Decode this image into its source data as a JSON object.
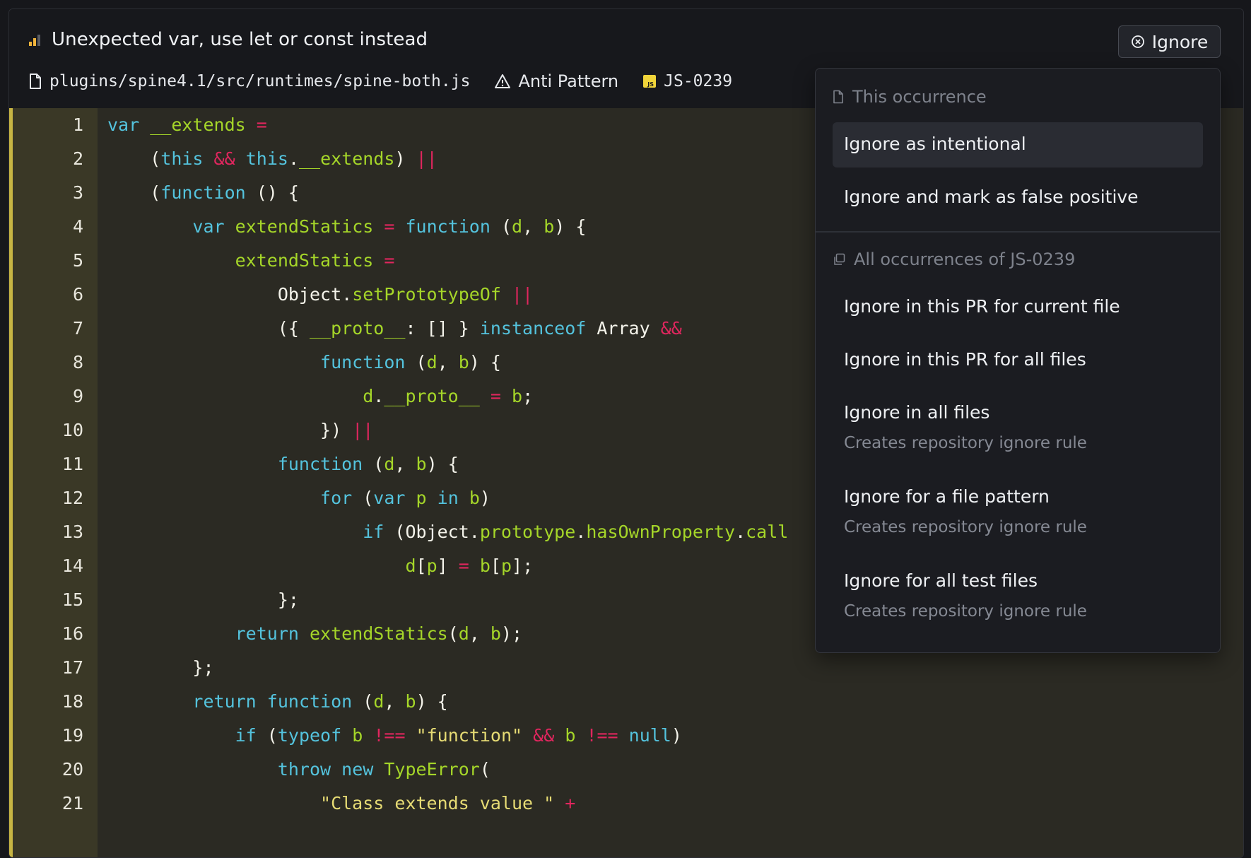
{
  "issue": {
    "title": "Unexpected var, use let or const instead",
    "file_path": "plugins/spine4.1/src/runtimes/spine-both.js",
    "category": "Anti Pattern",
    "language_badge": "JS",
    "issue_code": "JS-0239"
  },
  "ignore_button": {
    "label": "Ignore"
  },
  "dropdown": {
    "section_this": {
      "title": "This occurrence",
      "items": [
        {
          "label": "Ignore as intentional"
        },
        {
          "label": "Ignore and mark as false positive"
        }
      ]
    },
    "section_all": {
      "title": "All occurrences of JS-0239",
      "items": [
        {
          "label": "Ignore in this PR for current file"
        },
        {
          "label": "Ignore in this PR for all files"
        },
        {
          "label": "Ignore in all files",
          "sub": "Creates repository ignore rule"
        },
        {
          "label": "Ignore for a file pattern",
          "sub": "Creates repository ignore rule"
        },
        {
          "label": "Ignore for all test files",
          "sub": "Creates repository ignore rule"
        }
      ]
    }
  },
  "code": {
    "line_numbers": [
      "1",
      "2",
      "3",
      "4",
      "5",
      "6",
      "7",
      "8",
      "9",
      "10",
      "11",
      "12",
      "13",
      "14",
      "15",
      "16",
      "17",
      "18",
      "19",
      "20",
      "21"
    ],
    "lines": [
      [
        [
          "k",
          "var"
        ],
        [
          "w",
          " "
        ],
        [
          "f",
          "__extends"
        ],
        [
          "w",
          " "
        ],
        [
          "p",
          "="
        ]
      ],
      [
        [
          "w",
          "    ("
        ],
        [
          "k",
          "this"
        ],
        [
          "w",
          " "
        ],
        [
          "p",
          "&&"
        ],
        [
          "w",
          " "
        ],
        [
          "k",
          "this"
        ],
        [
          "w",
          "."
        ],
        [
          "f",
          "__extends"
        ],
        [
          "w",
          ") "
        ],
        [
          "p",
          "||"
        ]
      ],
      [
        [
          "w",
          "    ("
        ],
        [
          "k",
          "function"
        ],
        [
          "w",
          " () {"
        ]
      ],
      [
        [
          "w",
          "        "
        ],
        [
          "k",
          "var"
        ],
        [
          "w",
          " "
        ],
        [
          "f",
          "extendStatics"
        ],
        [
          "w",
          " "
        ],
        [
          "p",
          "="
        ],
        [
          "w",
          " "
        ],
        [
          "k",
          "function"
        ],
        [
          "w",
          " ("
        ],
        [
          "f",
          "d"
        ],
        [
          "w",
          ", "
        ],
        [
          "f",
          "b"
        ],
        [
          "w",
          ") {"
        ]
      ],
      [
        [
          "w",
          "            "
        ],
        [
          "f",
          "extendStatics"
        ],
        [
          "w",
          " "
        ],
        [
          "p",
          "="
        ]
      ],
      [
        [
          "w",
          "                Object."
        ],
        [
          "f",
          "setPrototypeOf"
        ],
        [
          "w",
          " "
        ],
        [
          "p",
          "||"
        ]
      ],
      [
        [
          "w",
          "                ({ "
        ],
        [
          "f",
          "__proto__"
        ],
        [
          "w",
          ": [] } "
        ],
        [
          "k",
          "instanceof"
        ],
        [
          "w",
          " Array "
        ],
        [
          "p",
          "&&"
        ]
      ],
      [
        [
          "w",
          "                    "
        ],
        [
          "k",
          "function"
        ],
        [
          "w",
          " ("
        ],
        [
          "f",
          "d"
        ],
        [
          "w",
          ", "
        ],
        [
          "f",
          "b"
        ],
        [
          "w",
          ") {"
        ]
      ],
      [
        [
          "w",
          "                        "
        ],
        [
          "f",
          "d"
        ],
        [
          "w",
          "."
        ],
        [
          "f",
          "__proto__"
        ],
        [
          "w",
          " "
        ],
        [
          "p",
          "="
        ],
        [
          "w",
          " "
        ],
        [
          "f",
          "b"
        ],
        [
          "w",
          ";"
        ]
      ],
      [
        [
          "w",
          "                    }) "
        ],
        [
          "p",
          "||"
        ]
      ],
      [
        [
          "w",
          "                "
        ],
        [
          "k",
          "function"
        ],
        [
          "w",
          " ("
        ],
        [
          "f",
          "d"
        ],
        [
          "w",
          ", "
        ],
        [
          "f",
          "b"
        ],
        [
          "w",
          ") {"
        ]
      ],
      [
        [
          "w",
          "                    "
        ],
        [
          "k",
          "for"
        ],
        [
          "w",
          " ("
        ],
        [
          "k",
          "var"
        ],
        [
          "w",
          " "
        ],
        [
          "f",
          "p"
        ],
        [
          "w",
          " "
        ],
        [
          "k",
          "in"
        ],
        [
          "w",
          " "
        ],
        [
          "f",
          "b"
        ],
        [
          "w",
          ")"
        ]
      ],
      [
        [
          "w",
          "                        "
        ],
        [
          "k",
          "if"
        ],
        [
          "w",
          " (Object."
        ],
        [
          "f",
          "prototype"
        ],
        [
          "w",
          "."
        ],
        [
          "f",
          "hasOwnProperty"
        ],
        [
          "w",
          "."
        ],
        [
          "f",
          "call"
        ]
      ],
      [
        [
          "w",
          "                            "
        ],
        [
          "f",
          "d"
        ],
        [
          "w",
          "["
        ],
        [
          "f",
          "p"
        ],
        [
          "w",
          "] "
        ],
        [
          "p",
          "="
        ],
        [
          "w",
          " "
        ],
        [
          "f",
          "b"
        ],
        [
          "w",
          "["
        ],
        [
          "f",
          "p"
        ],
        [
          "w",
          "];"
        ]
      ],
      [
        [
          "w",
          "                };"
        ]
      ],
      [
        [
          "w",
          "            "
        ],
        [
          "k",
          "return"
        ],
        [
          "w",
          " "
        ],
        [
          "f",
          "extendStatics"
        ],
        [
          "w",
          "("
        ],
        [
          "f",
          "d"
        ],
        [
          "w",
          ", "
        ],
        [
          "f",
          "b"
        ],
        [
          "w",
          ");"
        ]
      ],
      [
        [
          "w",
          "        };"
        ]
      ],
      [
        [
          "w",
          "        "
        ],
        [
          "k",
          "return"
        ],
        [
          "w",
          " "
        ],
        [
          "k",
          "function"
        ],
        [
          "w",
          " ("
        ],
        [
          "f",
          "d"
        ],
        [
          "w",
          ", "
        ],
        [
          "f",
          "b"
        ],
        [
          "w",
          ") {"
        ]
      ],
      [
        [
          "w",
          "            "
        ],
        [
          "k",
          "if"
        ],
        [
          "w",
          " ("
        ],
        [
          "k",
          "typeof"
        ],
        [
          "w",
          " "
        ],
        [
          "f",
          "b"
        ],
        [
          "w",
          " "
        ],
        [
          "p",
          "!=="
        ],
        [
          "w",
          " "
        ],
        [
          "s",
          "\"function\""
        ],
        [
          "w",
          " "
        ],
        [
          "p",
          "&&"
        ],
        [
          "w",
          " "
        ],
        [
          "f",
          "b"
        ],
        [
          "w",
          " "
        ],
        [
          "p",
          "!=="
        ],
        [
          "w",
          " "
        ],
        [
          "k",
          "null"
        ],
        [
          "w",
          ")"
        ]
      ],
      [
        [
          "w",
          "                "
        ],
        [
          "k",
          "throw"
        ],
        [
          "w",
          " "
        ],
        [
          "k",
          "new"
        ],
        [
          "w",
          " "
        ],
        [
          "f",
          "TypeError"
        ],
        [
          "w",
          "("
        ]
      ],
      [
        [
          "w",
          "                    "
        ],
        [
          "s",
          "\"Class extends value \""
        ],
        [
          "w",
          " "
        ],
        [
          "p",
          "+"
        ]
      ]
    ]
  }
}
